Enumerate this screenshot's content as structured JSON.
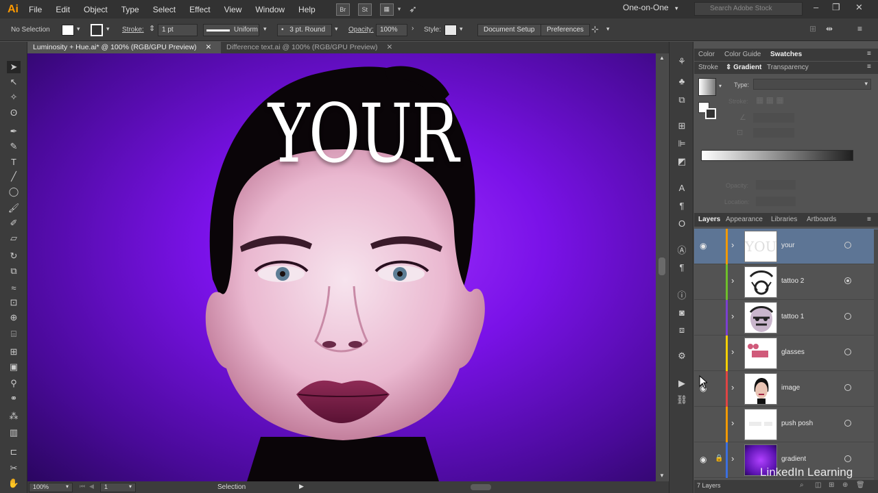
{
  "app": {
    "logo": "Ai",
    "menu": [
      "File",
      "Edit",
      "Object",
      "Type",
      "Select",
      "Effect",
      "View",
      "Window",
      "Help"
    ],
    "bridge_label": "Br",
    "stock_label": "St",
    "workspace": "One-on-One",
    "stock_search_placeholder": "Search Adobe Stock"
  },
  "control_bar": {
    "selection_status": "No Selection",
    "stroke_label": "Stroke:",
    "stroke_weight": "1 pt",
    "stroke_profile": "Uniform",
    "brush": "3 pt. Round",
    "opacity_label": "Opacity:",
    "opacity_value": "100%",
    "style_label": "Style:",
    "document_setup": "Document Setup",
    "preferences": "Preferences"
  },
  "tabs": [
    {
      "label": "Luminosity + Hue.ai* @ 100% (RGB/GPU Preview)",
      "active": true
    },
    {
      "label": "Difference text.ai @ 100% (RGB/GPU Preview)",
      "active": false
    }
  ],
  "canvas": {
    "headline": "YOUR",
    "background_color": "#7a12e8"
  },
  "status_bar": {
    "zoom": "100%",
    "artboard_number": "1",
    "tool_name": "Selection"
  },
  "panels": {
    "top_tabs": [
      "Color",
      "Color Guide",
      "Swatches"
    ],
    "active_top_tab": "Swatches",
    "second_tabs": [
      "Stroke",
      "Gradient",
      "Transparency"
    ],
    "active_second_tab": "Gradient",
    "gradient": {
      "type_label": "Type:",
      "stroke_label": "Stroke:",
      "opacity_label": "Opacity:",
      "location_label": "Location:"
    },
    "layer_tabs": [
      "Layers",
      "Appearance",
      "Libraries",
      "Artboards"
    ],
    "active_layer_tab": "Layers",
    "layers": [
      {
        "name": "your",
        "color": "#f29900",
        "visible": true,
        "locked": false,
        "selected": true,
        "target_filled": false
      },
      {
        "name": "tattoo 2",
        "color": "#6fbf2a",
        "visible": false,
        "locked": false,
        "selected": false,
        "target_filled": true
      },
      {
        "name": "tattoo 1",
        "color": "#7a3fd1",
        "visible": false,
        "locked": false,
        "selected": false,
        "target_filled": false
      },
      {
        "name": "glasses",
        "color": "#f5d000",
        "visible": false,
        "locked": false,
        "selected": false,
        "target_filled": false
      },
      {
        "name": "image",
        "color": "#e04444",
        "visible": true,
        "locked": false,
        "selected": false,
        "target_filled": false
      },
      {
        "name": "push posh",
        "color": "#f29900",
        "visible": false,
        "locked": false,
        "selected": false,
        "target_filled": false
      },
      {
        "name": "gradient",
        "color": "#3b6fe0",
        "visible": true,
        "locked": true,
        "selected": false,
        "target_filled": false
      }
    ],
    "layers_count": "7 Layers"
  },
  "watermark": "LinkedIn Learning"
}
